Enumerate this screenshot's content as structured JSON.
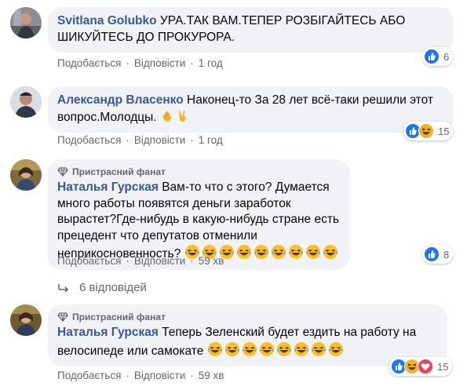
{
  "colors": {
    "like": "#1877f2",
    "haha": "#f7b125",
    "love": "#f33e58",
    "link": "#385898",
    "muted": "#65676b",
    "bubble": "#f0f2f5"
  },
  "comments": [
    {
      "author": "Svitlana Golubko",
      "text": "УРА.ТАК ВАМ.ТЕПЕР РОЗБІГАЙТЕСЬ АБО ШИКУЙТЕСЬ ДО ПРОКУРОРА.",
      "like_label": "Подобається",
      "reply_label": "Відповісти",
      "time": "1 год",
      "reaction_count": "6",
      "reaction_icons": [
        "like-icon"
      ]
    },
    {
      "author": "Александр Власенко",
      "text": "Наконец-то За 28 лет всё-таки решили этот вопрос.Молодцы.",
      "emojis": [
        "clapping-hands-icon",
        "victory-hand-icon"
      ],
      "like_label": "Подобається",
      "reply_label": "Відповісти",
      "time": "1 год",
      "reaction_count": "15",
      "reaction_icons": [
        "like-icon",
        "haha-icon"
      ]
    },
    {
      "badge": "Пристрасний фанат",
      "author": "Наталья Гурская",
      "text": "Вам-то что с этого? Думается много работы появятся деньги заработок вырастет?Где-нибудь в какую-нибудь стране есть прецедент что депутатов отменили неприкосновенность?",
      "emoji_count": 9,
      "like_label": "Подобається",
      "reply_label": "Відповісти",
      "time": "59 хв",
      "reaction_count": "8",
      "reaction_icons": [
        "like-icon"
      ]
    },
    {
      "badge": "Пристрасний фанат",
      "author": "Наталья Гурская",
      "text": "Теперь Зеленский будет ездить на работу на велосипеде или самокате",
      "emoji_count": 8,
      "like_label": "Подобається",
      "reply_label": "Відповісти",
      "time": "59 хв",
      "reaction_count": "15",
      "reaction_icons": [
        "like-icon",
        "haha-icon",
        "love-icon"
      ]
    }
  ],
  "replies_link": "6 відповідей",
  "separator": "·"
}
